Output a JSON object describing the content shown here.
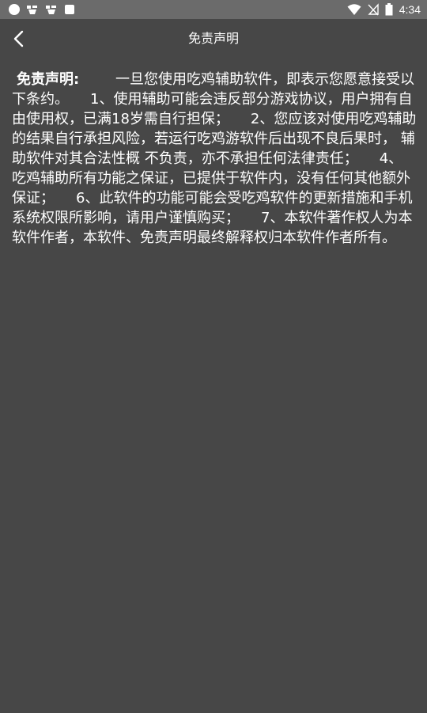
{
  "status_bar": {
    "time": "4:34",
    "icons_left": [
      "circle-notification-icon",
      "app-notification-icon",
      "app-notification-icon",
      "square-notification-icon"
    ],
    "icons_right": [
      "wifi-icon",
      "no-signal-icon",
      "battery-icon"
    ]
  },
  "toolbar": {
    "title": "免责声明",
    "back_icon": "chevron-left-icon"
  },
  "content": {
    "label": "免责声明:",
    "body": "一旦您使用吃鸡辅助软件，即表示您愿意接受以下条约。　　1、使用辅助可能会违反部分游戏协议，用户拥有自由使用权，已满18岁需自行担保；　　2、您应该对使用吃鸡辅助的结果自行承担风险，若运行吃鸡游软件后出现不良后果时， 辅助软件对其合法性概 不负责，亦不承担任何法律责任；　　4、吃鸡辅助所有功能之保证，已提供于软件内，没有任何其他额外保证；　　6、此软件的功能可能会受吃鸡软件的更新措施和手机系统权限所影响，请用户谨慎购买；　　7、本软件著作权人为本软件作者，本软件、免责声明最终解释权归本软件作者所有。"
  },
  "colors": {
    "background": "#474747",
    "status_bar": "#6b6b6b",
    "text": "#ffffff"
  }
}
